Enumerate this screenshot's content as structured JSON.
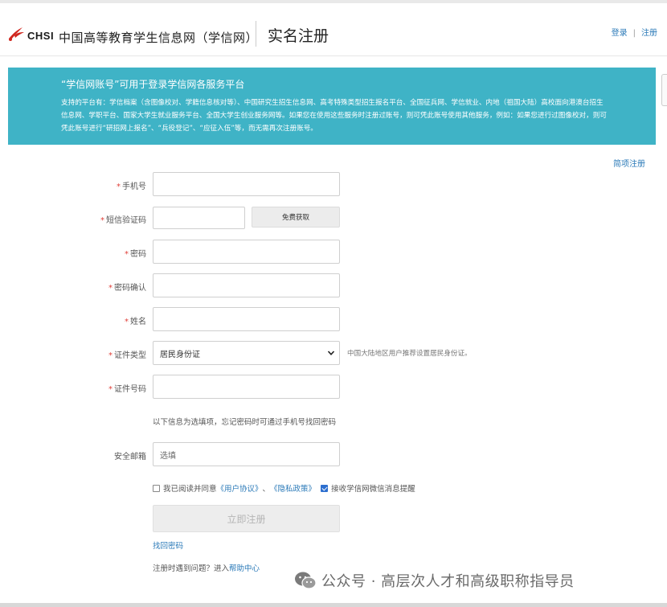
{
  "header": {
    "logo_text": "CHSI",
    "site_name": "中国高等教育学生信息网（学信网）",
    "page_title": "实名注册",
    "login_link": "登录",
    "divider": "|",
    "register_link": "注册"
  },
  "banner": {
    "title": "“学信网账号”可用于登录学信网各服务平台",
    "body": "支持的平台有：学信档案（含图像校对、学籍信息核对等）、中国研究生招生信息网、高考特殊类型招生报名平台、全国征兵网、学信就业、内地（祖国大陆）高校面向港澳台招生信息网、学职平台、国家大学生就业服务平台、全国大学生创业服务网等。如果您在使用这些服务时注册过账号，则可凭此账号使用其他服务，例如：如果您进行过图像校对，则可凭此账号进行“研招网上报名”、“兵役登记”、“应征入伍”等，而无需再次注册账号。"
  },
  "simple_register_link": "简项注册",
  "form": {
    "required_mark": "*",
    "phone_label": "手机号",
    "sms_label": "短信验证码",
    "get_code_button": "免费获取",
    "password_label": "密码",
    "password_confirm_label": "密码确认",
    "name_label": "姓名",
    "id_type_label": "证件类型",
    "id_type_value": "居民身份证",
    "id_type_hint": "中国大陆地区用户推荐设置居民身份证。",
    "id_number_label": "证件号码",
    "optional_note": "以下信息为选填项，忘记密码时可通过手机号找回密码",
    "email_label": "安全邮箱",
    "email_placeholder": "选填"
  },
  "agreement": {
    "prefix": "我已阅读并同意",
    "user_agreement": "《用户协议》",
    "separator": "、",
    "privacy_policy": "《隐私政策》",
    "wechat_label": "接收学信网微信消息提醒",
    "agree_checked": false,
    "wechat_checked": true
  },
  "submit_button": "立即注册",
  "find_password_link": "找回密码",
  "help": {
    "prefix": "注册时遇到问题？进入",
    "link": "帮助中心"
  },
  "watermark": "公众号 · 高层次人才和高级职称指导员",
  "colors": {
    "banner": "#3fb3c6",
    "link": "#2b7ab8",
    "required": "#e0403a",
    "logo_red": "#d0261e"
  }
}
